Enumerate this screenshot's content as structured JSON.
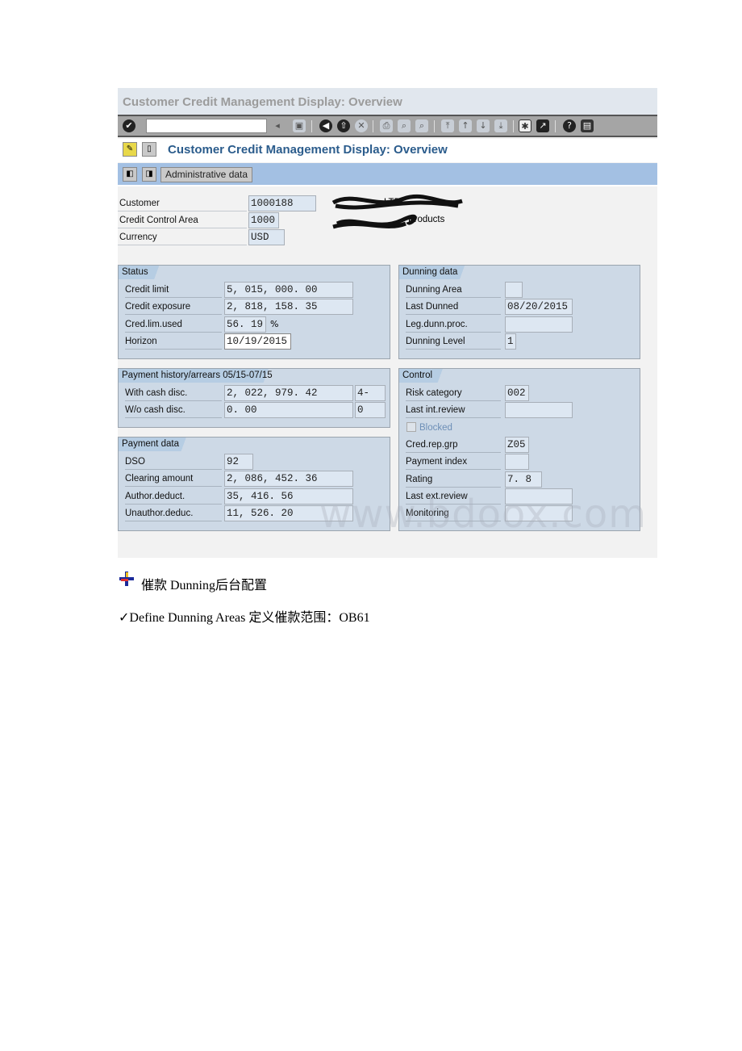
{
  "window_title": "Customer Credit Management Display: Overview",
  "toolbar": {
    "command_field": "",
    "icons": [
      "enter-icon",
      "save-icon",
      "back-icon",
      "exit-icon",
      "cancel-icon",
      "print-icon",
      "find-icon",
      "find-next-icon",
      "first-page-icon",
      "prev-page-icon",
      "next-page-icon",
      "last-page-icon",
      "new-session-icon",
      "shortcut-icon",
      "help-icon",
      "layout-icon"
    ]
  },
  "screen_title": "Customer Credit Management Display: Overview",
  "app_toolbar": {
    "admin_label": "Administrative data"
  },
  "header": {
    "customer_label": "Customer",
    "customer": "1000188",
    "customer_name_suffix": "LTD",
    "cca_label": "Credit Control Area",
    "cca": "1000",
    "cca_name_suffix": "Products",
    "currency_label": "Currency",
    "currency": "USD"
  },
  "panels": [
    {
      "title": "Status",
      "rows": [
        {
          "label": "Credit limit",
          "value": "5, 015, 000. 00"
        },
        {
          "label": "Credit exposure",
          "value": "2, 818, 158. 35"
        },
        {
          "label": "Cred.lim.used",
          "value": "56. 19",
          "suffix": "%"
        },
        {
          "label": "Horizon",
          "value": "10/19/2015"
        }
      ]
    },
    {
      "title": "Dunning data",
      "rows": [
        {
          "label": "Dunning Area",
          "value": ""
        },
        {
          "label": "Last Dunned",
          "value": "08/20/2015"
        },
        {
          "label": "Leg.dunn.proc.",
          "value": ""
        },
        {
          "label": "Dunning Level",
          "value": "1"
        }
      ]
    },
    {
      "title": "Payment history/arrears 05/15-07/15",
      "rows": [
        {
          "label": "With cash disc.",
          "value": "2, 022, 979. 42",
          "extra": "4-"
        },
        {
          "label": "W/o cash disc.",
          "value": "0. 00",
          "extra": "0"
        }
      ]
    },
    {
      "title": "Control",
      "rows": [
        {
          "label": "Risk category",
          "value": "002"
        },
        {
          "label": "Last int.review",
          "value": ""
        },
        {
          "label": "Blocked",
          "checkbox": true,
          "checked": false
        },
        {
          "label": "Cred.rep.grp",
          "value": "Z05"
        },
        {
          "label": "Payment index",
          "value": ""
        },
        {
          "label": "Rating",
          "value": "7. 8"
        },
        {
          "label": "Last ext.review",
          "value": ""
        },
        {
          "label": "Monitoring",
          "value": ""
        }
      ]
    },
    {
      "title": "Payment data",
      "rows": [
        {
          "label": "DSO",
          "value": "92"
        },
        {
          "label": "Clearing amount",
          "value": "2, 086, 452. 36"
        },
        {
          "label": "Author.deduct.",
          "value": "35, 416. 56"
        },
        {
          "label": "Unauthor.deduc.",
          "value": "11, 526. 20"
        }
      ]
    }
  ],
  "watermark": "www.bdoox.com",
  "doc": {
    "heading": "催款 Dunning后台配置",
    "item": "✓Define Dunning Areas 定义催款范围：OB61"
  }
}
